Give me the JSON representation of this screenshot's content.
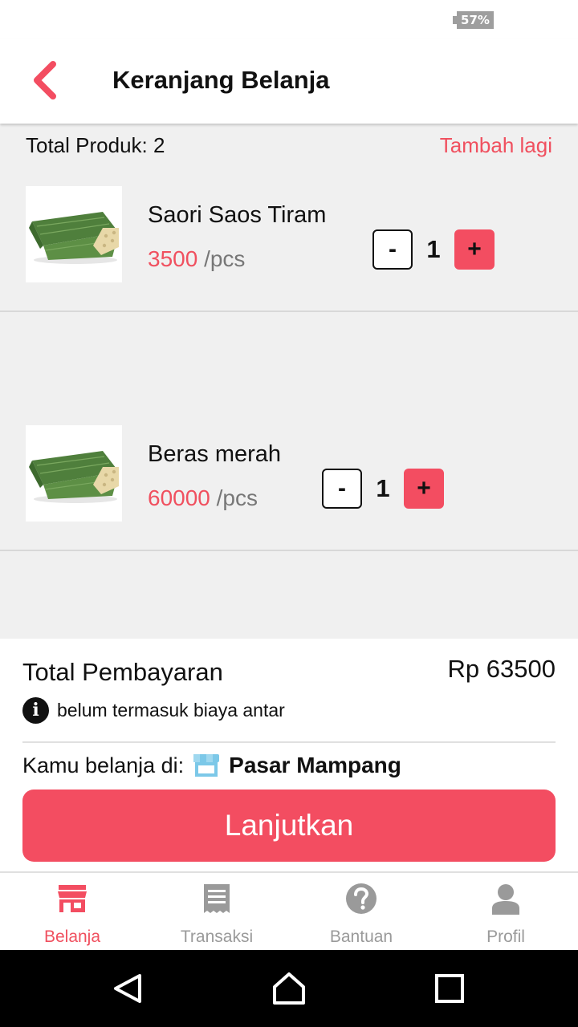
{
  "status_bar": {
    "battery": "57%"
  },
  "header": {
    "title": "Keranjang Belanja",
    "back_icon": "chevron-left-icon"
  },
  "cart": {
    "total_label": "Total Produk:",
    "total_count": "2",
    "add_more": "Tambah lagi",
    "items": [
      {
        "name": "Saori Saos Tiram",
        "price": "3500",
        "unit": "/pcs",
        "quantity": "1",
        "minus": "-",
        "plus": "+"
      },
      {
        "name": "Beras merah",
        "price": "60000",
        "unit": "/pcs",
        "quantity": "1",
        "minus": "-",
        "plus": "+"
      }
    ]
  },
  "checkout": {
    "total_label": "Total Pembayaran",
    "total_value": "Rp 63500",
    "note": "belum termasuk biaya antar",
    "shop_label": "Kamu belanja di:",
    "shop_name": "Pasar Mampang",
    "button": "Lanjutkan"
  },
  "bottom_nav": [
    {
      "label": "Belanja",
      "icon": "store-icon",
      "active": true
    },
    {
      "label": "Transaksi",
      "icon": "receipt-icon",
      "active": false
    },
    {
      "label": "Bantuan",
      "icon": "help-icon",
      "active": false
    },
    {
      "label": "Profil",
      "icon": "person-icon",
      "active": false
    }
  ],
  "colors": {
    "accent": "#f34d61",
    "accent_text": "#f0505f",
    "inactive": "#9a9a9a",
    "shop_icon": "#7cc8e8"
  }
}
